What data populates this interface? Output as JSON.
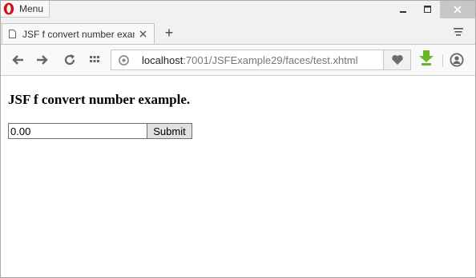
{
  "titlebar": {
    "menu_label": "Menu",
    "logo_icon": "opera-logo-icon",
    "minimize_icon": "minimize-icon",
    "maximize_icon": "maximize-icon",
    "close_icon": "close-icon"
  },
  "tabs": [
    {
      "title": "JSF f convert number example.",
      "icon": "page-icon",
      "close_icon": "close-icon"
    }
  ],
  "tabstrip": {
    "new_tab_label": "+",
    "menu_icon": "tab-menu-icon"
  },
  "toolbar": {
    "back_icon": "arrow-left-icon",
    "forward_icon": "arrow-right-icon",
    "reload_icon": "reload-icon",
    "speed_dial_icon": "grid-icon",
    "site_icon": "site-info-icon",
    "url_host": "localhost",
    "url_path": ":7001/JSFExample29/faces/test.xhtml",
    "heart_icon": "heart-icon",
    "download_icon": "download-icon",
    "account_icon": "account-icon"
  },
  "page": {
    "heading": "JSF f convert number example.",
    "input_value": "0.00",
    "submit_label": "Submit"
  },
  "colors": {
    "download_green": "#6ab42a",
    "opera_red": "#cc0f16"
  }
}
